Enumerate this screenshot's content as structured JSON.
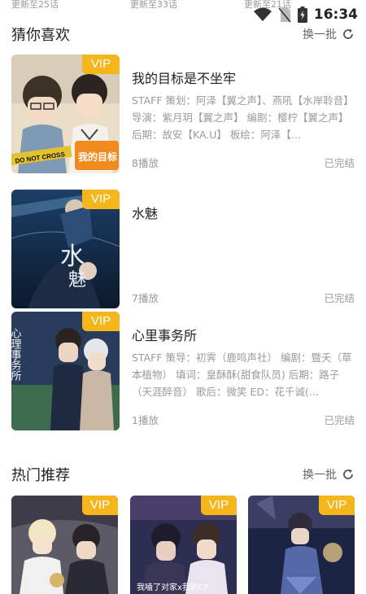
{
  "status": {
    "time": "16:34"
  },
  "top_cut": [
    "更新至25话",
    "更新至33话",
    "更新至21话"
  ],
  "guess": {
    "title": "猜你喜欢",
    "refresh_label": "换一批",
    "items": [
      {
        "vip": "VIP",
        "title": "我的目标是不坐牢",
        "desc": "STAFF 策划：阿泽【翼之声】、燕吼【水岸聆音】 导演：紫月玥【翼之声】 编剧：樱柠【翼之声】 后期：故安【KA.U】 板绘：阿泽【...",
        "plays": "8播放",
        "status": "已完结",
        "cover_text": [
          "DO NOT CROSS",
          "我的目标"
        ]
      },
      {
        "vip": "VIP",
        "title": "水魅",
        "desc": "",
        "plays": "7播放",
        "status": "已完结",
        "cover_text": [
          "水",
          "魅"
        ]
      },
      {
        "vip": "VIP",
        "title": "心里事务所",
        "desc": "STAFF 策导：初霁（鹿鸣声社） 编剧：暨夭（草本植物） 填词：皇酥酥(甜食队员) 后期：路子（天涯醉音） 歌后：微笑 ED：花千诚(...",
        "plays": "1播放",
        "status": "已完结",
        "cover_text": [
          "心理事务所"
        ]
      }
    ]
  },
  "hot": {
    "title": "热门推荐",
    "refresh_label": "换一批",
    "items": [
      {
        "vip": "VIP"
      },
      {
        "vip": "VIP",
        "cover_text": "我嗑了对家x我的CP"
      },
      {
        "vip": "VIP"
      }
    ]
  },
  "colors": {
    "vip": "#f4b61a",
    "text_secondary": "#9a9a9a"
  },
  "icons": [
    "wifi-icon",
    "no-sim-icon",
    "battery-icon",
    "refresh-icon"
  ]
}
